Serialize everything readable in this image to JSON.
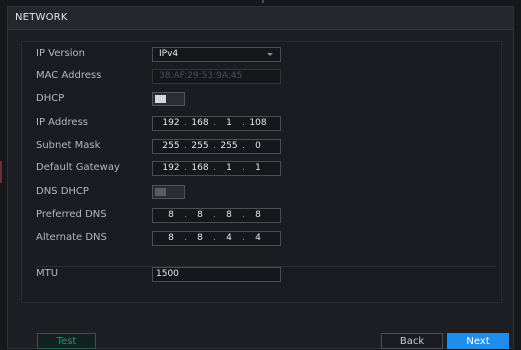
{
  "window": {
    "title": "NETWORK"
  },
  "fields": {
    "ip_version": {
      "label": "IP Version",
      "value": "IPv4"
    },
    "mac_address": {
      "label": "MAC Address",
      "value": "38:AF:29:53:9A:45"
    },
    "dhcp": {
      "label": "DHCP",
      "enabled": true
    },
    "ip_address": {
      "label": "IP Address",
      "octets": [
        "192",
        "168",
        "1",
        "108"
      ]
    },
    "subnet_mask": {
      "label": "Subnet Mask",
      "octets": [
        "255",
        "255",
        "255",
        "0"
      ]
    },
    "default_gateway": {
      "label": "Default Gateway",
      "octets": [
        "192",
        "168",
        "1",
        "1"
      ]
    },
    "dns_dhcp": {
      "label": "DNS DHCP",
      "enabled": false
    },
    "preferred_dns": {
      "label": "Preferred DNS",
      "octets": [
        "8",
        "8",
        "8",
        "8"
      ]
    },
    "alternate_dns": {
      "label": "Alternate DNS",
      "octets": [
        "8",
        "8",
        "4",
        "4"
      ]
    },
    "mtu": {
      "label": "MTU",
      "value": "1500"
    }
  },
  "buttons": {
    "test": "Test",
    "back": "Back",
    "next": "Next"
  },
  "colors": {
    "accent": "#1e8eea",
    "test": "#2f8d79",
    "background": "#1e1f24"
  }
}
